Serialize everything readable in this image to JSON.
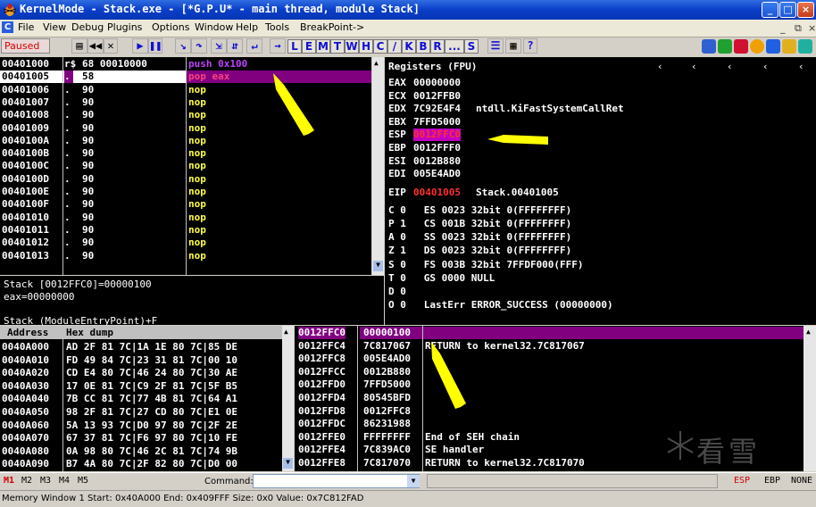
{
  "window": {
    "title": "KernelMode - Stack.exe - [*G.P.U* - main thread, module Stack]"
  },
  "menu": {
    "items": [
      "File",
      "View",
      "Debug",
      "Plugins",
      "Options",
      "Window",
      "Help",
      "Tools",
      "BreakPoint->"
    ]
  },
  "toolbar": {
    "status": "Paused",
    "letters": [
      "L",
      "E",
      "M",
      "T",
      "W",
      "H",
      "C",
      "/",
      "K",
      "B",
      "R",
      "...",
      "S"
    ]
  },
  "disasm": {
    "rows": [
      {
        "addr": "00401000",
        "mark": "r$",
        "hex": "68 00010000",
        "instr": "push 0x100"
      },
      {
        "addr": "00401005",
        "mark": ".",
        "hex": "58",
        "instr": "pop eax"
      },
      {
        "addr": "00401006",
        "mark": ".",
        "hex": "90",
        "instr": "nop"
      },
      {
        "addr": "00401007",
        "mark": ".",
        "hex": "90",
        "instr": "nop"
      },
      {
        "addr": "00401008",
        "mark": ".",
        "hex": "90",
        "instr": "nop"
      },
      {
        "addr": "00401009",
        "mark": ".",
        "hex": "90",
        "instr": "nop"
      },
      {
        "addr": "0040100A",
        "mark": ".",
        "hex": "90",
        "instr": "nop"
      },
      {
        "addr": "0040100B",
        "mark": ".",
        "hex": "90",
        "instr": "nop"
      },
      {
        "addr": "0040100C",
        "mark": ".",
        "hex": "90",
        "instr": "nop"
      },
      {
        "addr": "0040100D",
        "mark": ".",
        "hex": "90",
        "instr": "nop"
      },
      {
        "addr": "0040100E",
        "mark": ".",
        "hex": "90",
        "instr": "nop"
      },
      {
        "addr": "0040100F",
        "mark": ".",
        "hex": "90",
        "instr": "nop"
      },
      {
        "addr": "00401010",
        "mark": ".",
        "hex": "90",
        "instr": "nop"
      },
      {
        "addr": "00401011",
        "mark": ".",
        "hex": "90",
        "instr": "nop"
      },
      {
        "addr": "00401012",
        "mark": ".",
        "hex": "90",
        "instr": "nop"
      },
      {
        "addr": "00401013",
        "mark": ".",
        "hex": "90",
        "instr": "nop"
      }
    ]
  },
  "info": {
    "line1": "Stack [0012FFC0]=00000100",
    "line2": "eax=00000000",
    "line3": "Stack (ModuleEntryPoint)+F"
  },
  "registers": {
    "header": "Registers (FPU)",
    "lines": [
      {
        "name": "EAX",
        "val": "00000000",
        "extra": ""
      },
      {
        "name": "ECX",
        "val": "0012FFB0",
        "extra": ""
      },
      {
        "name": "EDX",
        "val": "7C92E4F4",
        "extra": "ntdll.KiFastSystemCallRet"
      },
      {
        "name": "EBX",
        "val": "7FFD5000",
        "extra": ""
      },
      {
        "name": "ESP",
        "val": "0012FFC0",
        "extra": ""
      },
      {
        "name": "EBP",
        "val": "0012FFF0",
        "extra": ""
      },
      {
        "name": "ESI",
        "val": "0012B880",
        "extra": ""
      },
      {
        "name": "EDI",
        "val": "005E4AD0",
        "extra": ""
      }
    ],
    "eip": {
      "name": "EIP",
      "val": "00401005",
      "extra": "Stack.00401005"
    },
    "flags": [
      "C 0   ES 0023 32bit 0(FFFFFFFF)",
      "P 1   CS 001B 32bit 0(FFFFFFFF)",
      "A 0   SS 0023 32bit 0(FFFFFFFF)",
      "Z 1   DS 0023 32bit 0(FFFFFFFF)",
      "S 0   FS 003B 32bit 7FFDF000(FFF)",
      "T 0   GS 0000 NULL",
      "D 0",
      "O 0   LastErr ERROR_SUCCESS (00000000)"
    ]
  },
  "dump": {
    "header_addr": "Address",
    "header_hex": "Hex dump",
    "rows": [
      {
        "addr": "0040A000",
        "hex": "AD 2F 81 7C|1A 1E 80 7C|85 DE"
      },
      {
        "addr": "0040A010",
        "hex": "FD 49 84 7C|23 31 81 7C|00 10"
      },
      {
        "addr": "0040A020",
        "hex": "CD E4 80 7C|46 24 80 7C|30 AE"
      },
      {
        "addr": "0040A030",
        "hex": "17 0E 81 7C|C9 2F 81 7C|5F B5"
      },
      {
        "addr": "0040A040",
        "hex": "7B CC 81 7C|77 4B 81 7C|64 A1"
      },
      {
        "addr": "0040A050",
        "hex": "98 2F 81 7C|27 CD 80 7C|E1 0E"
      },
      {
        "addr": "0040A060",
        "hex": "5A 13 93 7C|D0 97 80 7C|2F 2E"
      },
      {
        "addr": "0040A070",
        "hex": "67 37 81 7C|F6 97 80 7C|10 FE"
      },
      {
        "addr": "0040A080",
        "hex": "0A 98 80 7C|46 2C 81 7C|74 9B"
      },
      {
        "addr": "0040A090",
        "hex": "B7 4A 80 7C|2F 82 80 7C|D0 00"
      }
    ]
  },
  "stack": {
    "rows": [
      {
        "addr": "0012FFC0",
        "val": "00000100",
        "comment": ""
      },
      {
        "addr": "0012FFC4",
        "val": "7C817067",
        "comment": "RETURN to kernel32.7C817067"
      },
      {
        "addr": "0012FFC8",
        "val": "005E4AD0",
        "comment": ""
      },
      {
        "addr": "0012FFCC",
        "val": "0012B880",
        "comment": ""
      },
      {
        "addr": "0012FFD0",
        "val": "7FFD5000",
        "comment": ""
      },
      {
        "addr": "0012FFD4",
        "val": "80545BFD",
        "comment": ""
      },
      {
        "addr": "0012FFD8",
        "val": "0012FFC8",
        "comment": ""
      },
      {
        "addr": "0012FFDC",
        "val": "86231988",
        "comment": ""
      },
      {
        "addr": "0012FFE0",
        "val": "FFFFFFFF",
        "comment": "End of SEH chain"
      },
      {
        "addr": "0012FFE4",
        "val": "7C839AC0",
        "comment": "SE handler"
      },
      {
        "addr": "0012FFE8",
        "val": "7C817070",
        "comment": "RETURN to kernel32.7C817070"
      }
    ]
  },
  "commandbar": {
    "tabs": [
      "M1",
      "M2",
      "M3",
      "M4",
      "M5"
    ],
    "command_label": "Command:",
    "right": [
      "ESP",
      "EBP",
      "NONE"
    ]
  },
  "status": {
    "text": "Memory Window 1  Start: 0x40A000  End: 0x409FFF  Size: 0x0  Value: 0x7C812FAD"
  },
  "watermark": "看雪"
}
